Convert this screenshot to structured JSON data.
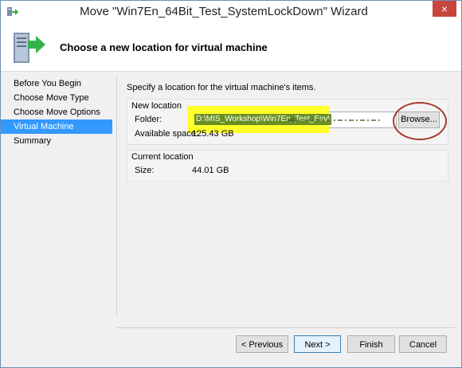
{
  "window": {
    "title": "Move \"Win7En_64Bit_Test_SystemLockDown\" Wizard",
    "close_label": "×"
  },
  "header": {
    "title": "Choose a new location for virtual machine"
  },
  "nav": {
    "items": [
      {
        "label": "Before You Begin",
        "active": false
      },
      {
        "label": "Choose Move Type",
        "active": false
      },
      {
        "label": "Choose Move Options",
        "active": false
      },
      {
        "label": "Virtual Machine",
        "active": true
      },
      {
        "label": "Summary",
        "active": false
      }
    ]
  },
  "content": {
    "intro": "Specify a location for the virtual machine's items.",
    "new_location": {
      "group_label": "New location",
      "folder_label": "Folder:",
      "folder_value": "D:\\MIS_Workshop\\Win7En_Test_Env\\",
      "browse_label": "Browse...",
      "space_label": "Available space:",
      "space_value": "125.43 GB"
    },
    "current_location": {
      "group_label": "Current location",
      "size_label": "Size:",
      "size_value": "44.01 GB"
    }
  },
  "buttons": {
    "previous": "< Previous",
    "next": "Next >",
    "finish": "Finish",
    "cancel": "Cancel"
  },
  "colors": {
    "active_nav": "#3399ff",
    "highlight": "#ffff2a",
    "annotation_circle": "#a63a2e",
    "annotation_arrow": "#556b2f"
  },
  "icons": {
    "app": "move-vm-icon",
    "header": "server-move-icon",
    "close": "close-icon"
  }
}
